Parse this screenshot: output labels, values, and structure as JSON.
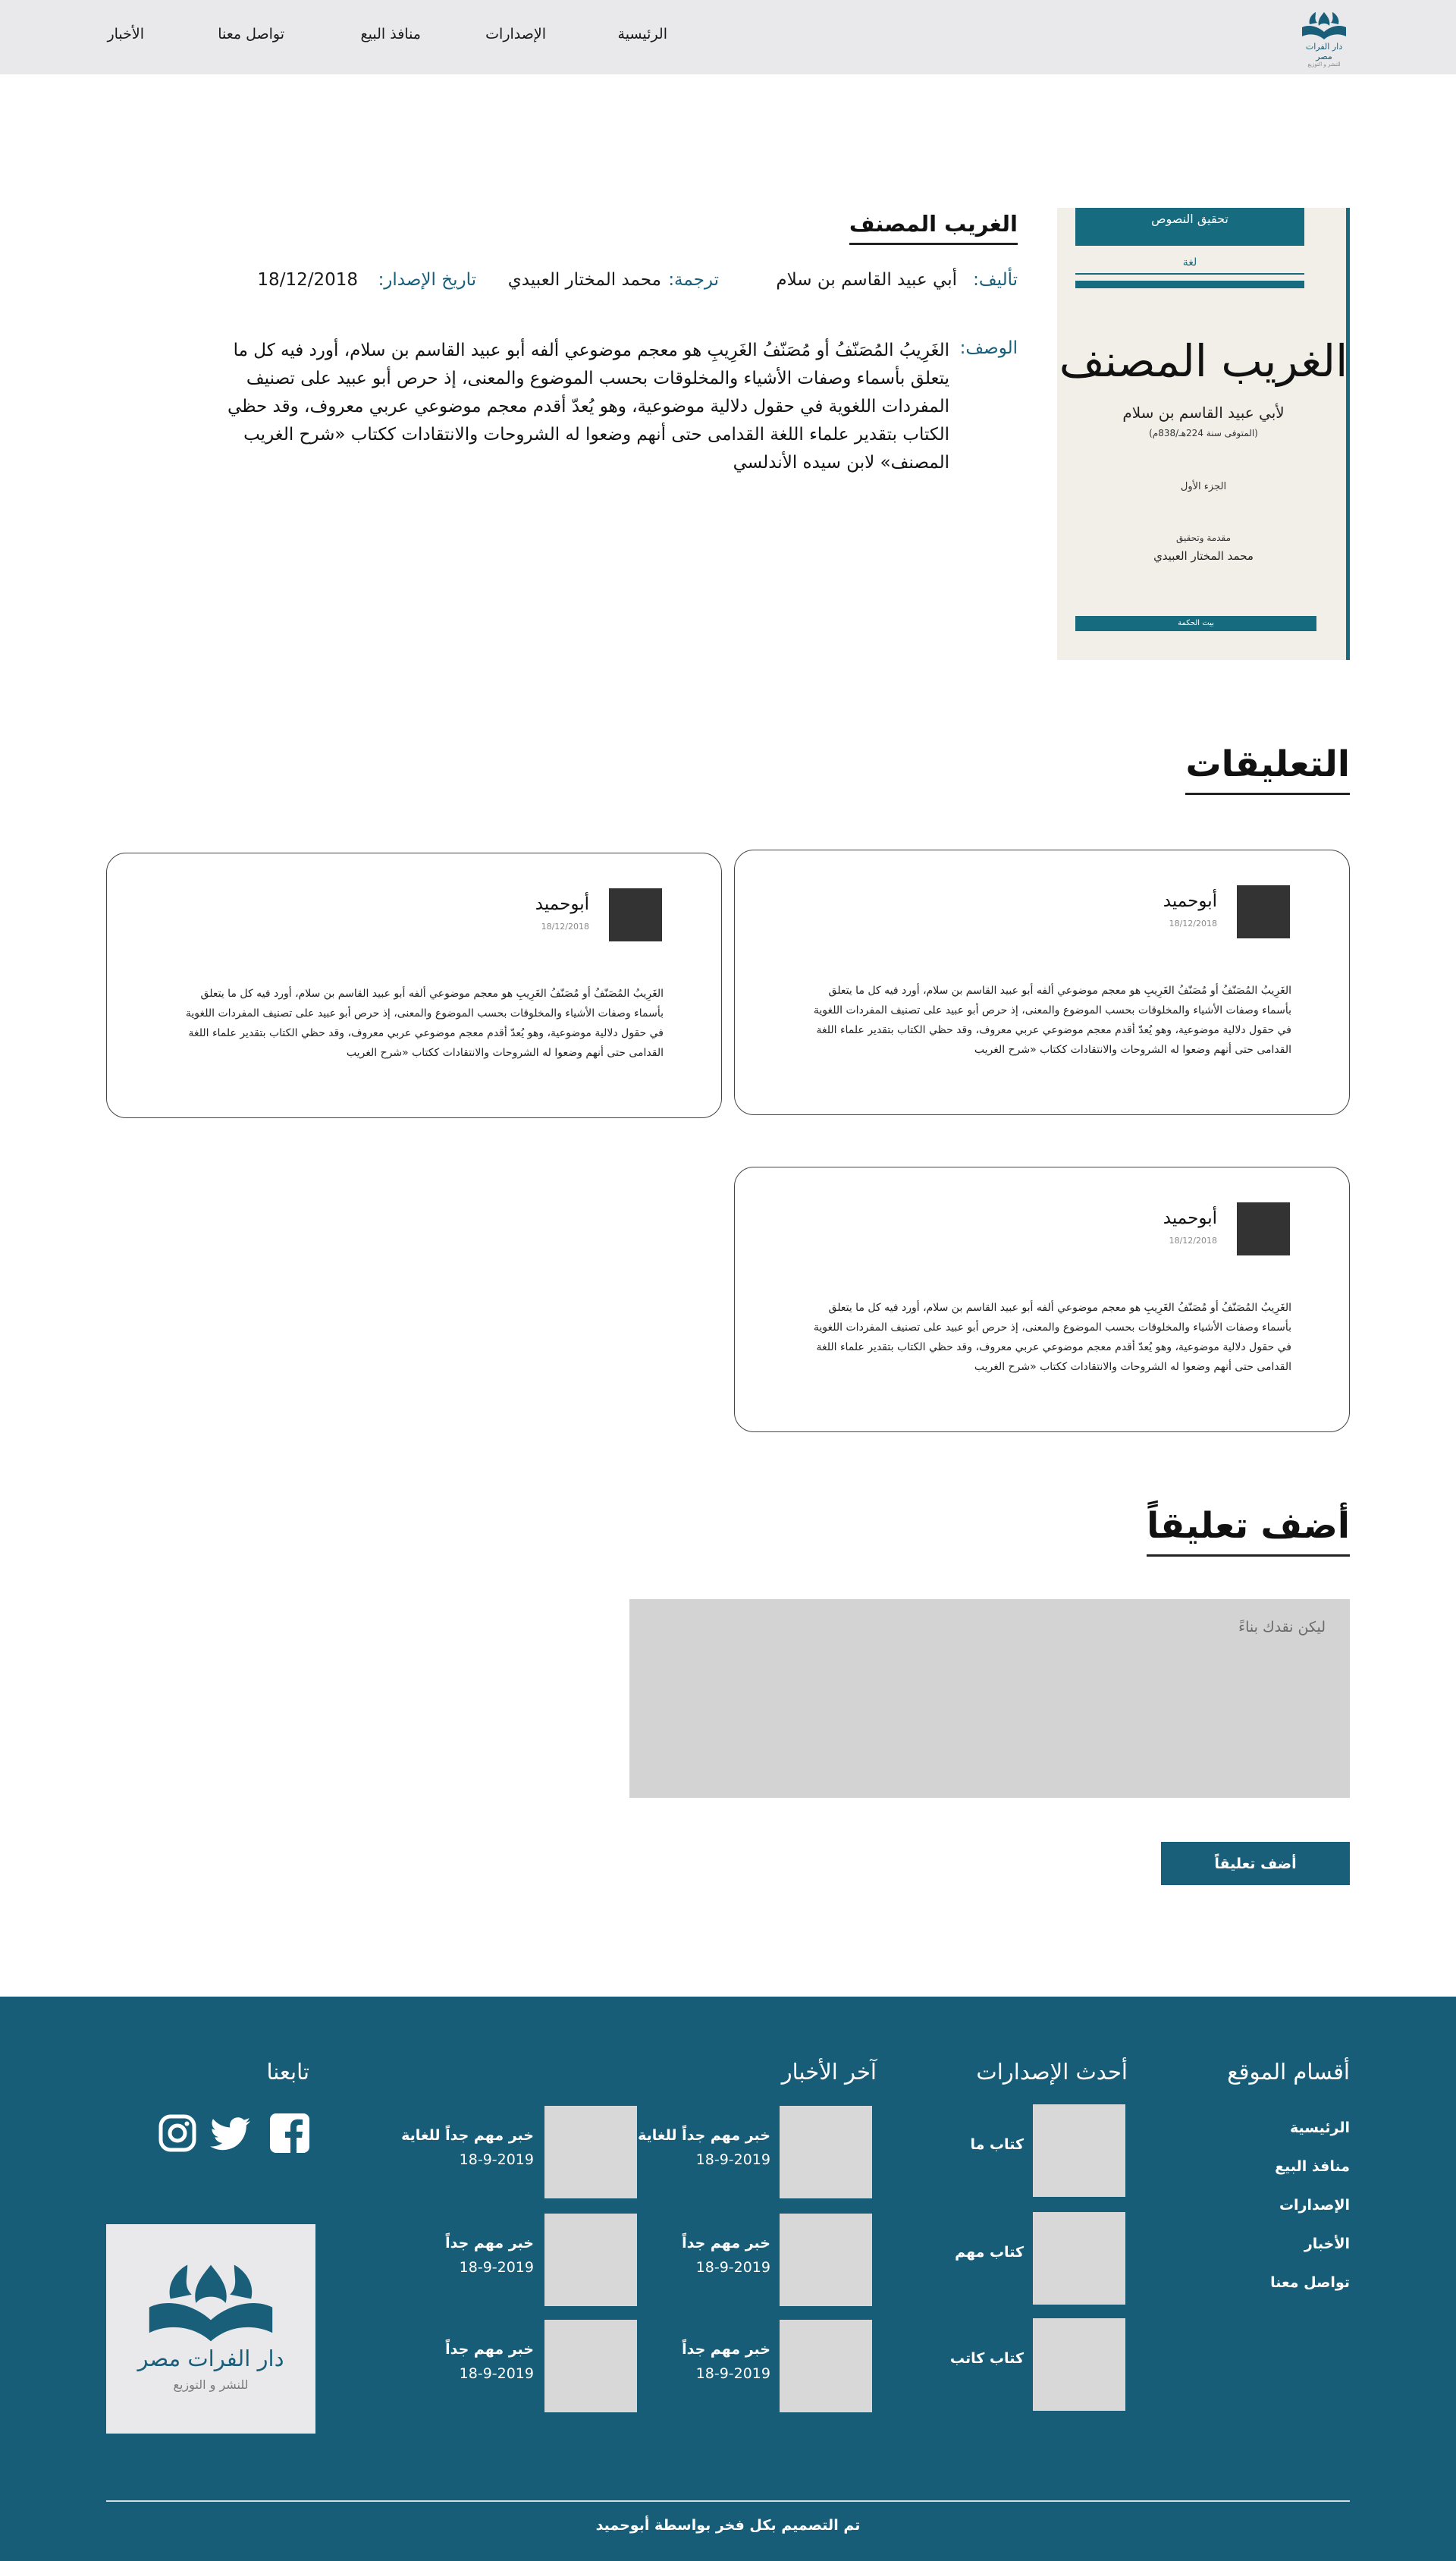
{
  "header": {
    "logo": {
      "name": "دار الفرات مصر",
      "tagline": "للنشر و التوزيع"
    },
    "nav": [
      "الرئيسية",
      "الإصدارات",
      "منافذ البيع",
      "تواصل معنا",
      "الأخبار"
    ]
  },
  "book": {
    "title": "الغريب المصنف",
    "author_label": "تأليف:",
    "author": "أبي عبيد القاسم بن سلام",
    "translator_label": "ترجمة:",
    "translator": "محمد المختار العبيدي",
    "date_label": "تاريخ الإصدار:",
    "date": "18/12/2018",
    "description_label": "الوصف:",
    "description": "الغَرِيبُ المُصَنّفُ أو مُصَنّفُ الغَرِيبِ هو معجم موضوعي ألفه أبو عبيد القاسم بن سلام، أورد فيه كل ما يتعلق بأسماء وصفات الأشياء والمخلوقات بحسب الموضوع والمعنى، إذ حرص أبو عبيد على تصنيف المفردات اللغوية في حقول دلالية موضوعية، وهو يُعدّ أقدم معجم موضوعي عربي معروف، وقد حظي الكتاب بتقدير علماء اللغة القدامى حتى أنهم وضعوا له الشروحات والانتقادات ككتاب «شرح الغريب المصنف» لابن سيده الأندلسي",
    "cover": {
      "series": "تحقيق النصوص",
      "subseries": "لغة",
      "title": "الغريب المصنف",
      "author": "لأبي عبيد القاسم بن سلام",
      "died": "(المتوفى سنة 224هـ/838م)",
      "part": "الجزء الأول",
      "edition_line": "مقدمة وتحقيق",
      "editor": "محمد المختار العبيدي",
      "publisher": "بيت الحكمة"
    }
  },
  "comments": {
    "title": "التعليقات",
    "items": [
      {
        "author": "أبوحميد",
        "date": "18/12/2018",
        "text": "الغَرِيبُ المُصَنّفُ أو مُصَنّفُ الغَرِيبِ هو معجم موضوعي ألفه أبو عبيد القاسم بن سلام، أورد فيه كل ما يتعلق بأسماء وصفات الأشياء والمخلوقات بحسب الموضوع والمعنى، إذ حرص أبو عبيد على تصنيف المفردات اللغوية في حقول دلالية موضوعية، وهو يُعدّ أقدم معجم موضوعي عربي معروف، وقد حظي الكتاب بتقدير علماء اللغة القدامى حتى أنهم وضعوا له الشروحات والانتقادات ككتاب «شرح الغريب"
      },
      {
        "author": "أبوحميد",
        "date": "18/12/2018",
        "text": "الغَرِيبُ المُصَنّفُ أو مُصَنّفُ الغَرِيبِ هو معجم موضوعي ألفه أبو عبيد القاسم بن سلام، أورد فيه كل ما يتعلق بأسماء وصفات الأشياء والمخلوقات بحسب الموضوع والمعنى، إذ حرص أبو عبيد على تصنيف المفردات اللغوية في حقول دلالية موضوعية، وهو يُعدّ أقدم معجم موضوعي عربي معروف، وقد حظي الكتاب بتقدير علماء اللغة القدامى حتى أنهم وضعوا له الشروحات والانتقادات ككتاب «شرح الغريب"
      },
      {
        "author": "أبوحميد",
        "date": "18/12/2018",
        "text": "الغَرِيبُ المُصَنّفُ أو مُصَنّفُ الغَرِيبِ هو معجم موضوعي ألفه أبو عبيد القاسم بن سلام، أورد فيه كل ما يتعلق بأسماء وصفات الأشياء والمخلوقات بحسب الموضوع والمعنى، إذ حرص أبو عبيد على تصنيف المفردات اللغوية في حقول دلالية موضوعية، وهو يُعدّ أقدم معجم موضوعي عربي معروف، وقد حظي الكتاب بتقدير علماء اللغة القدامى حتى أنهم وضعوا له الشروحات والانتقادات ككتاب «شرح الغريب"
      }
    ]
  },
  "add_comment": {
    "title": "أضف تعليقاً",
    "placeholder": "ليكن نقدك بناءً",
    "button": "أضف تعليقاً"
  },
  "footer": {
    "sections_title": "أقسام الموقع",
    "sections": [
      "الرئيسية",
      "منافذ البيع",
      "الإصدارات",
      "الأخبار",
      "تواصل معنا"
    ],
    "releases_title": "أحدث الإصدارات",
    "releases": [
      "كتاب ما",
      "كتاب مهم",
      "كتاب كاتب"
    ],
    "news_title": "آخر الأخبار",
    "news": [
      {
        "title": "خبر مهم جداً للغاية",
        "date": "18-9-2019"
      },
      {
        "title": "خبر مهم جداً للغاية",
        "date": "18-9-2019"
      },
      {
        "title": "خبر مهم جداً",
        "date": "18-9-2019"
      },
      {
        "title": "خبر مهم جداً",
        "date": "18-9-2019"
      },
      {
        "title": "خبر مهم جداً",
        "date": "18-9-2019"
      },
      {
        "title": "خبر مهم جداً",
        "date": "18-9-2019"
      }
    ],
    "follow_title": "تابعنا",
    "social": [
      "facebook-icon",
      "twitter-icon",
      "instagram-icon"
    ],
    "logo": {
      "name": "دار الفرات مصر",
      "tagline": "للنشر و التوزيع"
    },
    "credit": "تم التصميم بكل فخر بواسطة أبوحميد"
  },
  "colors": {
    "primary": "#1a5f7a",
    "footer_bg": "#175d78",
    "header_bg": "#e9e9eb",
    "avatar": "#333333"
  }
}
